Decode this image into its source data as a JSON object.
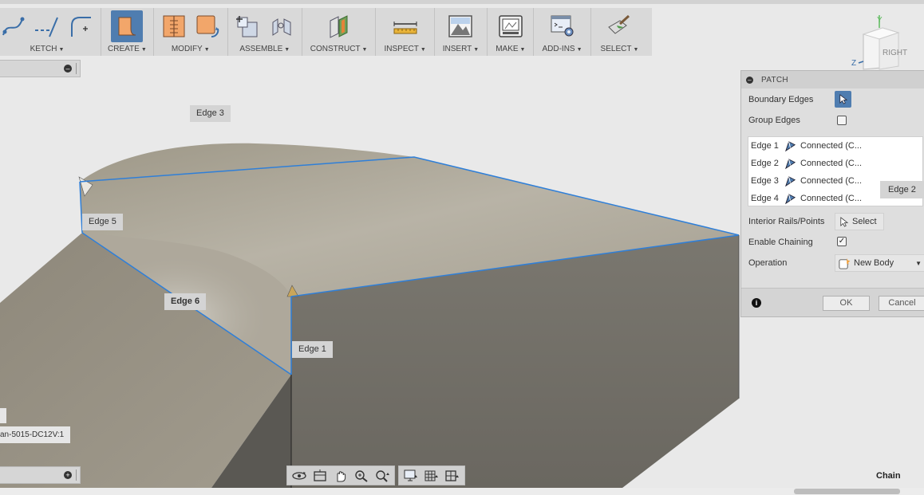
{
  "toolbar": {
    "groups": [
      {
        "label": "KETCH",
        "icons": [
          "spline-icon",
          "construction-line-icon",
          "fillet-sketch-icon"
        ]
      },
      {
        "label": "CREATE",
        "icons": [
          "patch-surface-icon"
        ]
      },
      {
        "label": "MODIFY",
        "icons": [
          "split-body-icon",
          "replace-face-icon"
        ]
      },
      {
        "label": "ASSEMBLE",
        "icons": [
          "new-component-icon",
          "joint-icon"
        ]
      },
      {
        "label": "CONSTRUCT",
        "icons": [
          "offset-plane-icon"
        ]
      },
      {
        "label": "INSPECT",
        "icons": [
          "measure-icon"
        ]
      },
      {
        "label": "INSERT",
        "icons": [
          "insert-image-icon"
        ]
      },
      {
        "label": "MAKE",
        "icons": [
          "3d-print-icon"
        ]
      },
      {
        "label": "ADD-INS",
        "icons": [
          "scripts-icon"
        ]
      },
      {
        "label": "SELECT",
        "icons": [
          "select-brush-icon"
        ]
      }
    ]
  },
  "viewport": {
    "edge_labels": {
      "edge3": "Edge 3",
      "edge5": "Edge 5",
      "edge6": "Edge 6",
      "edge1": "Edge 1"
    },
    "component_label": "an-5015-DC12V:1"
  },
  "viewcube": {
    "face": "RIGHT",
    "axis_x": "Z",
    "axis_y": "Y"
  },
  "patch_panel": {
    "title": "PATCH",
    "boundary_edges_label": "Boundary Edges",
    "group_edges_label": "Group Edges",
    "edges": [
      {
        "name": "Edge 1",
        "value": "Connected (C..."
      },
      {
        "name": "Edge 2",
        "value": "Connected (C..."
      },
      {
        "name": "Edge 3",
        "value": "Connected (C..."
      },
      {
        "name": "Edge 4",
        "value": "Connected (C..."
      }
    ],
    "floating_edge_label": "Edge 2",
    "interior_rails_label": "Interior Rails/Points",
    "select_label": "Select",
    "enable_chaining_label": "Enable Chaining",
    "enable_chaining_checked": true,
    "operation_label": "Operation",
    "operation_value": "New Body",
    "ok_label": "OK",
    "cancel_label": "Cancel"
  },
  "status": {
    "chain_label": "Chain"
  },
  "colors": {
    "accent": "#4f7db0",
    "edge_highlight": "#2f7fd8",
    "surface": "#9d978b"
  }
}
